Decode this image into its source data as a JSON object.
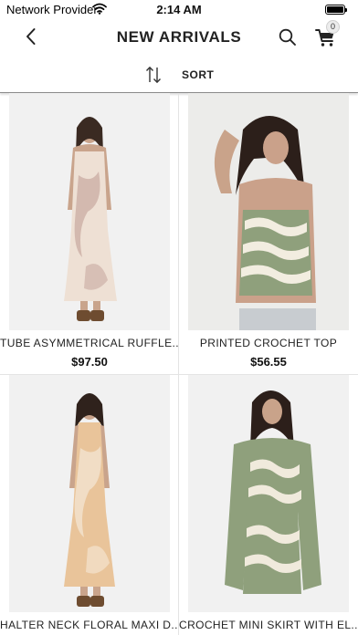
{
  "status_bar": {
    "carrier": "Network Provider",
    "time": "2:14 AM",
    "icons": [
      "wifi-icon",
      "battery-icon"
    ]
  },
  "nav": {
    "title": "NEW ARRIVALS",
    "back_icon": "chevron-left-icon",
    "search_icon": "search-icon",
    "cart_icon": "cart-icon",
    "cart_count": "0"
  },
  "sort": {
    "icon": "sort-arrows-icon",
    "label": "SORT"
  },
  "products": [
    {
      "name": "TUBE ASYMMETRICAL RUFFLE...",
      "price": "$97.50",
      "photo_bg": "#f1f1f1",
      "garment": "#eee0d4",
      "accent": "#c8a8a0"
    },
    {
      "name": "PRINTED CROCHET TOP",
      "price": "$56.55",
      "photo_bg": "#ececea",
      "garment": "#8fa07c",
      "accent": "#f2ede0"
    },
    {
      "name": "HALTER NECK FLORAL MAXI D...",
      "price": "",
      "photo_bg": "#f1f1f1",
      "garment": "#e9c49a",
      "accent": "#f3e4cf"
    },
    {
      "name": "CROCHET MINI SKIRT WITH EL...",
      "price": "",
      "photo_bg": "#f1f1f1",
      "garment": "#8fa07c",
      "accent": "#f0eadc"
    }
  ]
}
